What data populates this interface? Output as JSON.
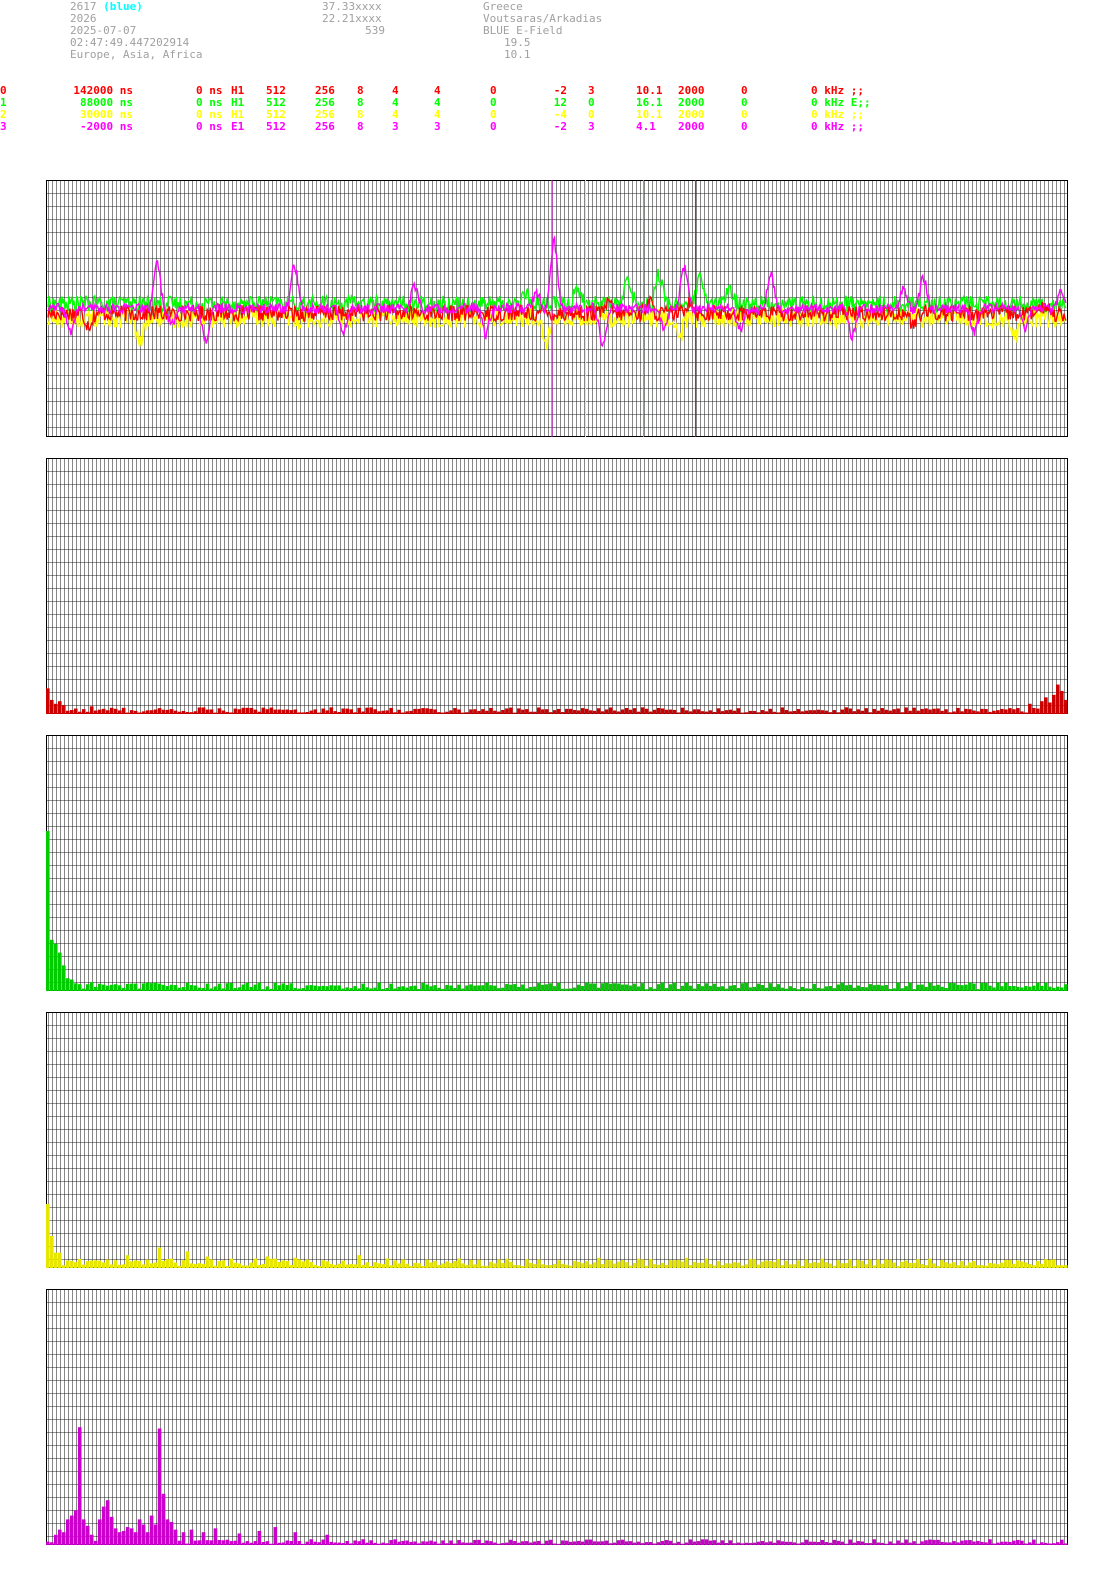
{
  "header": {
    "col1": [
      "2617",
      "2026",
      "2025-07-07",
      "02:47:49.447202914",
      "Europe, Asia, Africa"
    ],
    "col1_suffix": "(blue)",
    "col2": [
      "37.33xxxx",
      "22.21xxxx",
      "539"
    ],
    "col3": [
      "Greece",
      "Voutsaras/Arkadias",
      "BLUE E-Field",
      "19.5",
      "10.1"
    ]
  },
  "colors": {
    "red": "#ff0000",
    "green": "#00ff00",
    "yellow": "#ffff00",
    "magenta": "#ff00ff",
    "cyan": "#00ffff",
    "grid": "#000000",
    "bar_red": "#cc0000",
    "bar_green": "#00cc00",
    "bar_yellow": "#e6e600",
    "bar_magenta": "#cc00cc"
  },
  "channels": [
    {
      "id": "0",
      "delay": "142000 ns",
      "offset": "0 ns",
      "type": "H1",
      "a": "512",
      "b": "256",
      "c": "8",
      "d": "4",
      "e": "4",
      "f": "0",
      "g": "-2",
      "h": "3",
      "i": "10.1",
      "j": "2000",
      "k": "0",
      "l": "0 kHz ;;"
    },
    {
      "id": "1",
      "delay": "88000 ns",
      "offset": "0 ns",
      "type": "H1",
      "a": "512",
      "b": "256",
      "c": "8",
      "d": "4",
      "e": "4",
      "f": "0",
      "g": "12",
      "h": "0",
      "i": "16.1",
      "j": "2000",
      "k": "0",
      "l": "0 kHz E;;"
    },
    {
      "id": "2",
      "delay": "30000 ns",
      "offset": "0 ns",
      "type": "H1",
      "a": "512",
      "b": "256",
      "c": "8",
      "d": "4",
      "e": "4",
      "f": "0",
      "g": "-4",
      "h": "0",
      "i": "10.1",
      "j": "2000",
      "k": "0",
      "l": "0 kHz ;;"
    },
    {
      "id": "3",
      "delay": "-2000 ns",
      "offset": "0 ns",
      "type": "E1",
      "a": "512",
      "b": "256",
      "c": "8",
      "d": "3",
      "e": "3",
      "f": "0",
      "g": "-2",
      "h": "3",
      "i": "4.1",
      "j": "2000",
      "k": "0",
      "l": "0 kHz ;;"
    }
  ],
  "chart_data": [
    {
      "type": "line",
      "title": "",
      "x_count": 256,
      "ylim": [
        -8,
        8
      ],
      "markers": [
        {
          "series": "3",
          "x": 0.495
        },
        {
          "series": "2",
          "x": 0.528
        },
        {
          "series": "1",
          "x": 0.585
        },
        {
          "series": "0",
          "x": 0.636
        }
      ],
      "series": [
        {
          "name": "0",
          "noise": 0.5,
          "offset": -0.3,
          "spikes": [
            {
              "x": 0.04,
              "v": -0.7
            },
            {
              "x": 0.55,
              "v": 0.6
            },
            {
              "x": 0.59,
              "v": 0.7
            },
            {
              "x": 0.63,
              "v": 0.8
            },
            {
              "x": 0.85,
              "v": -0.7
            },
            {
              "x": 0.98,
              "v": 0.5
            }
          ]
        },
        {
          "name": "1",
          "noise": 0.5,
          "offset": 0.3,
          "spikes": [
            {
              "x": 0.47,
              "v": 0.6
            },
            {
              "x": 0.52,
              "v": 1.0
            },
            {
              "x": 0.57,
              "v": 1.5
            },
            {
              "x": 0.6,
              "v": 1.8
            },
            {
              "x": 0.64,
              "v": 1.5
            },
            {
              "x": 0.67,
              "v": 0.8
            }
          ]
        },
        {
          "name": "2",
          "noise": 0.6,
          "offset": -0.6,
          "spikes": [
            {
              "x": 0.09,
              "v": -1.6
            },
            {
              "x": 0.49,
              "v": -1.4
            },
            {
              "x": 0.62,
              "v": -1.2
            },
            {
              "x": 0.95,
              "v": -1.3
            }
          ]
        },
        {
          "name": "3",
          "noise": 0.3,
          "offset": 0.0,
          "spikes": [
            {
              "x": 0.022,
              "v": -1.5
            },
            {
              "x": 0.107,
              "v": 2.8
            },
            {
              "x": 0.122,
              "v": -1.0
            },
            {
              "x": 0.155,
              "v": -2.0
            },
            {
              "x": 0.242,
              "v": 2.7
            },
            {
              "x": 0.29,
              "v": -1.6
            },
            {
              "x": 0.36,
              "v": 1.4
            },
            {
              "x": 0.43,
              "v": -1.6
            },
            {
              "x": 0.48,
              "v": 1.0
            },
            {
              "x": 0.497,
              "v": 4.2
            },
            {
              "x": 0.545,
              "v": -2.4
            },
            {
              "x": 0.605,
              "v": -1.2
            },
            {
              "x": 0.625,
              "v": 2.6
            },
            {
              "x": 0.68,
              "v": -1.4
            },
            {
              "x": 0.71,
              "v": 2.2
            },
            {
              "x": 0.79,
              "v": -1.8
            },
            {
              "x": 0.84,
              "v": 1.2
            },
            {
              "x": 0.86,
              "v": 1.9
            },
            {
              "x": 0.91,
              "v": -1.5
            },
            {
              "x": 0.96,
              "v": -1.2
            },
            {
              "x": 0.995,
              "v": 1.0
            }
          ]
        }
      ]
    },
    {
      "type": "bar",
      "series": "0",
      "bins": 256,
      "ymax": 20,
      "base": 0.35,
      "peaks": [
        {
          "i": 0,
          "v": 2.0
        },
        {
          "i": 1,
          "v": 1.1
        },
        {
          "i": 2,
          "v": 0.8
        },
        {
          "i": 3,
          "v": 1.0
        },
        {
          "i": 4,
          "v": 0.7
        },
        {
          "i": 11,
          "v": 0.6
        },
        {
          "i": 246,
          "v": 0.8
        },
        {
          "i": 249,
          "v": 1.0
        },
        {
          "i": 250,
          "v": 1.3
        },
        {
          "i": 251,
          "v": 0.9
        },
        {
          "i": 252,
          "v": 1.5
        },
        {
          "i": 253,
          "v": 2.3
        },
        {
          "i": 254,
          "v": 1.8
        },
        {
          "i": 255,
          "v": 1.1
        }
      ]
    },
    {
      "type": "bar",
      "series": "1",
      "bins": 256,
      "ymax": 20,
      "base": 0.45,
      "peaks": [
        {
          "i": 0,
          "v": 12.5
        },
        {
          "i": 1,
          "v": 4.0
        },
        {
          "i": 2,
          "v": 3.7
        },
        {
          "i": 3,
          "v": 3.0
        },
        {
          "i": 4,
          "v": 2.0
        },
        {
          "i": 5,
          "v": 1.0
        },
        {
          "i": 6,
          "v": 0.9
        },
        {
          "i": 7,
          "v": 0.6
        },
        {
          "i": 11,
          "v": 0.7
        }
      ]
    },
    {
      "type": "bar",
      "series": "2",
      "bins": 256,
      "ymax": 20,
      "base": 0.5,
      "peaks": [
        {
          "i": 0,
          "v": 5.0
        },
        {
          "i": 1,
          "v": 2.5
        },
        {
          "i": 2,
          "v": 1.2
        },
        {
          "i": 3,
          "v": 1.2
        },
        {
          "i": 20,
          "v": 1.0
        },
        {
          "i": 28,
          "v": 1.6
        },
        {
          "i": 35,
          "v": 1.3
        },
        {
          "i": 40,
          "v": 0.9
        },
        {
          "i": 55,
          "v": 0.9
        },
        {
          "i": 62,
          "v": 0.8
        },
        {
          "i": 78,
          "v": 1.0
        },
        {
          "i": 138,
          "v": 0.8
        },
        {
          "i": 160,
          "v": 0.8
        }
      ]
    },
    {
      "type": "bar",
      "series": "3",
      "bins": 256,
      "ymax": 20,
      "base": 0.3,
      "peaks": [
        {
          "i": 2,
          "v": 0.8
        },
        {
          "i": 3,
          "v": 1.2
        },
        {
          "i": 4,
          "v": 1.0
        },
        {
          "i": 5,
          "v": 2.0
        },
        {
          "i": 6,
          "v": 2.3
        },
        {
          "i": 7,
          "v": 2.7
        },
        {
          "i": 8,
          "v": 9.2
        },
        {
          "i": 9,
          "v": 2.0
        },
        {
          "i": 10,
          "v": 1.5
        },
        {
          "i": 11,
          "v": 0.8
        },
        {
          "i": 13,
          "v": 2.0
        },
        {
          "i": 14,
          "v": 3.0
        },
        {
          "i": 15,
          "v": 3.5
        },
        {
          "i": 16,
          "v": 2.2
        },
        {
          "i": 17,
          "v": 1.3
        },
        {
          "i": 18,
          "v": 1.0
        },
        {
          "i": 19,
          "v": 1.1
        },
        {
          "i": 20,
          "v": 1.4
        },
        {
          "i": 21,
          "v": 1.3
        },
        {
          "i": 22,
          "v": 1.0
        },
        {
          "i": 23,
          "v": 2.0
        },
        {
          "i": 24,
          "v": 1.6
        },
        {
          "i": 25,
          "v": 1.0
        },
        {
          "i": 26,
          "v": 2.3
        },
        {
          "i": 27,
          "v": 1.6
        },
        {
          "i": 28,
          "v": 9.1
        },
        {
          "i": 29,
          "v": 4.0
        },
        {
          "i": 30,
          "v": 2.0
        },
        {
          "i": 31,
          "v": 1.8
        },
        {
          "i": 32,
          "v": 1.2
        },
        {
          "i": 34,
          "v": 1.0
        },
        {
          "i": 36,
          "v": 1.2
        },
        {
          "i": 39,
          "v": 1.0
        },
        {
          "i": 42,
          "v": 1.3
        },
        {
          "i": 48,
          "v": 0.9
        },
        {
          "i": 53,
          "v": 1.1
        },
        {
          "i": 57,
          "v": 1.4
        },
        {
          "i": 62,
          "v": 1.0
        },
        {
          "i": 70,
          "v": 0.8
        }
      ]
    }
  ]
}
